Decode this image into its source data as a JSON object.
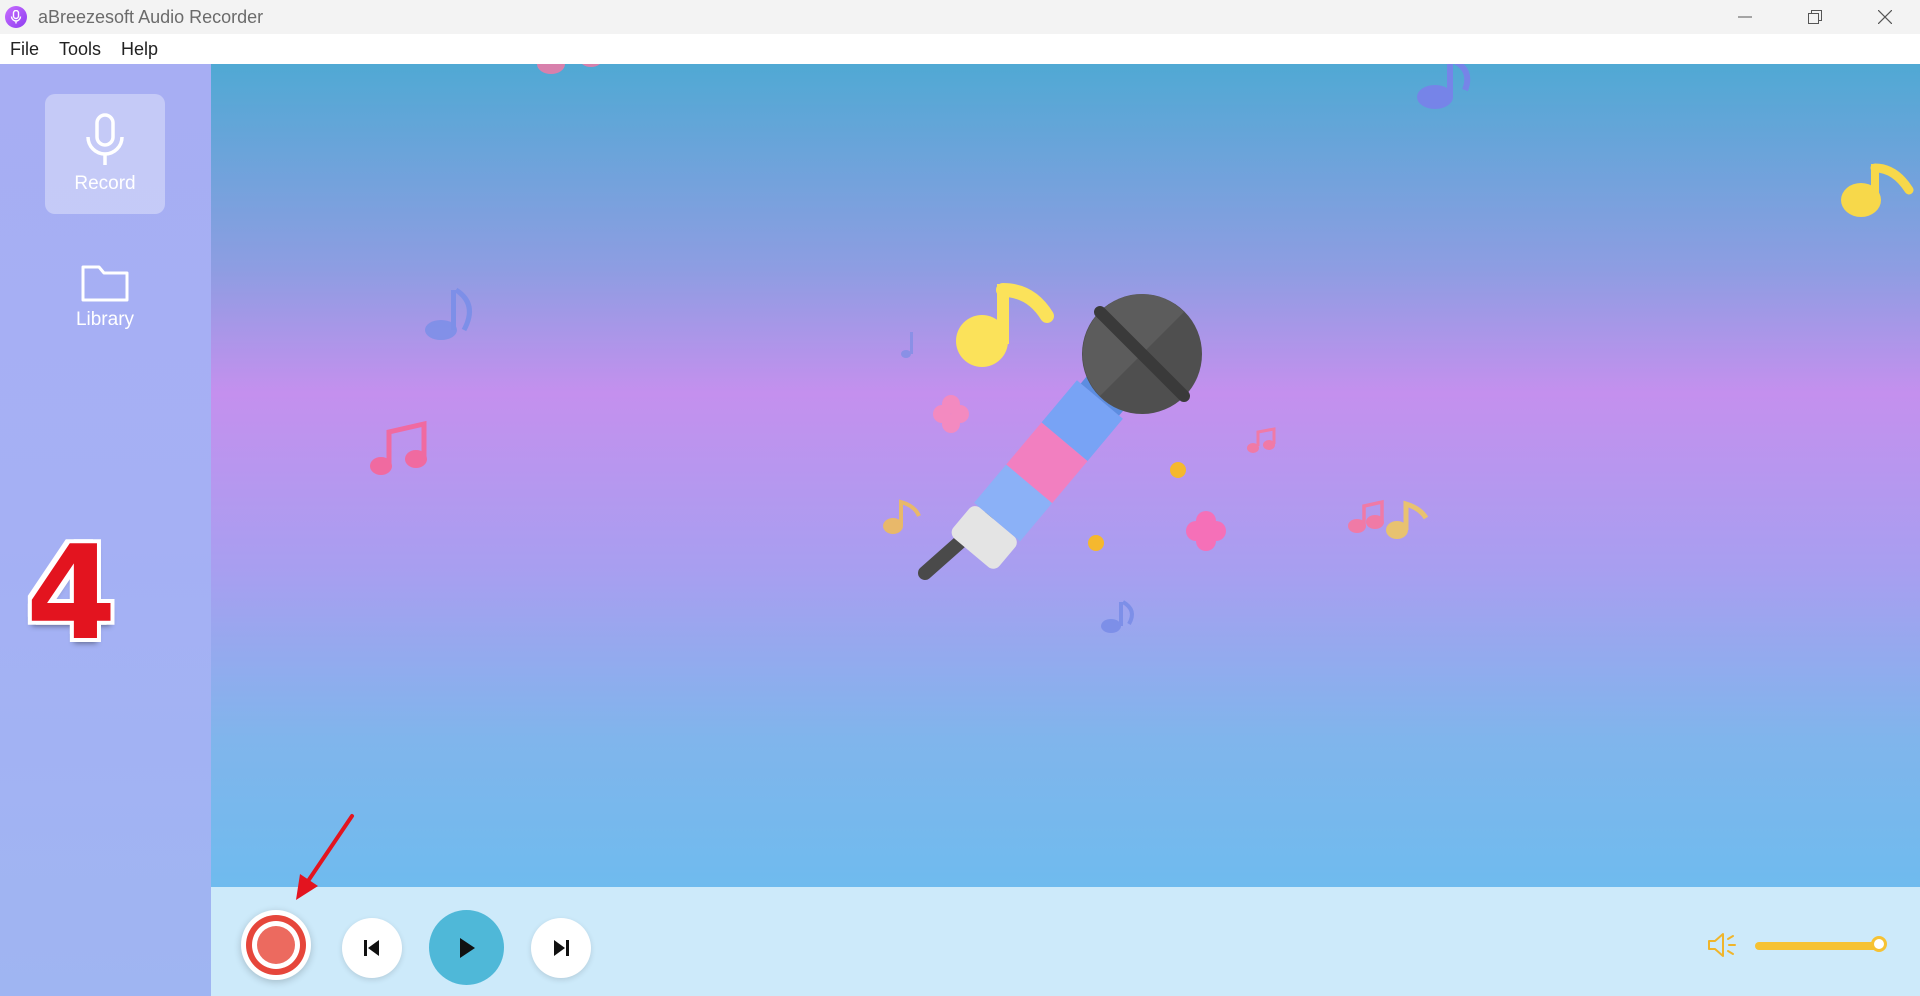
{
  "window": {
    "title": "aBreezesoft Audio Recorder",
    "icon": "microphone-icon",
    "controls": [
      "minimize-icon",
      "restore-icon",
      "close-icon"
    ]
  },
  "menu": {
    "file": "File",
    "tools": "Tools",
    "help": "Help"
  },
  "sidebar": {
    "items": [
      {
        "label": "Record",
        "icon": "microphone-icon",
        "active": true
      },
      {
        "label": "Library",
        "icon": "folder-icon",
        "active": false
      }
    ]
  },
  "annotation": {
    "step": "4",
    "arrow_color": "#e3141f"
  },
  "player": {
    "record_icon": "record-icon",
    "prev_icon": "skip-back-icon",
    "play_icon": "play-icon",
    "next_icon": "skip-forward-icon",
    "volume_icon": "volume-icon",
    "volume_level": 1.0
  },
  "colors": {
    "accent_yellow": "#f6c233",
    "record_red": "#e6463b",
    "play_blue": "#4fb8d8"
  }
}
